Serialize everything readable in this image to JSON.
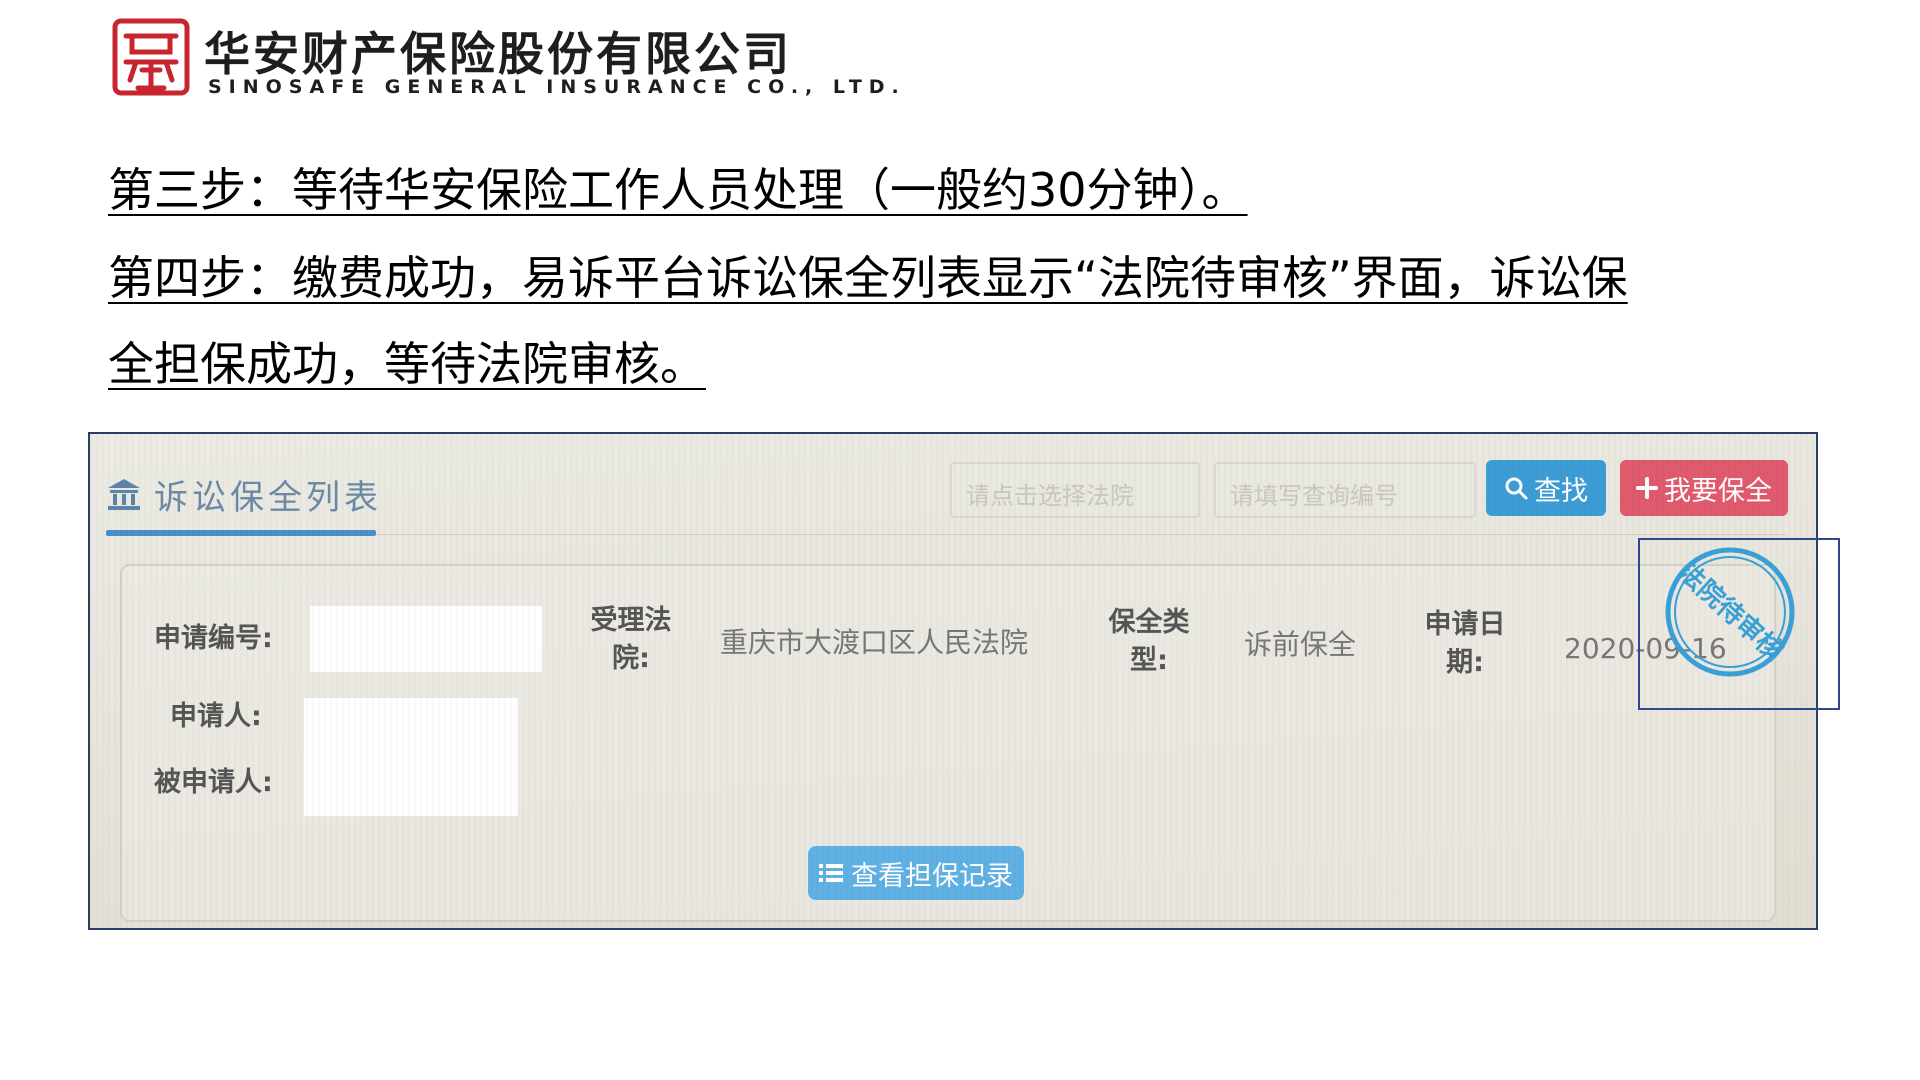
{
  "logo": {
    "cn": "华安财产保险股份有限公司",
    "en": "SINOSAFE GENERAL INSURANCE CO., LTD."
  },
  "steps": {
    "step3": "第三步：等待华安保险工作人员处理（一般约30分钟）。",
    "step4_line1": "第四步：缴费成功，易诉平台诉讼保全列表显示“法院待审核”界面，诉讼保",
    "step4_line2": "全担保成功，等待法院审核。"
  },
  "screenshot": {
    "panel_title": "诉讼保全列表",
    "court_placeholder": "请点击选择法院",
    "case_placeholder": "请填写查询编号",
    "find_button": "查找",
    "apply_button": "我要保全",
    "fields": {
      "application_no_label": "申请编号:",
      "court_label": "受理法院:",
      "court_value": "重庆市大渡口区人民法院",
      "type_label": "保全类型:",
      "type_value": "诉前保全",
      "date_label": "申请日期:",
      "date_value": "2020-09-16",
      "applicant_label": "申请人:",
      "respondent_label": "被申请人:"
    },
    "view_button": "查看担保记录",
    "stamp_text": "法院待审核"
  },
  "colors": {
    "find_button": "#3d9cd6",
    "apply_button": "#e05a6e",
    "title_accent": "#4a8fc8",
    "stamp": "#3aa0d8",
    "annotation_box": "#2c4a8a"
  }
}
